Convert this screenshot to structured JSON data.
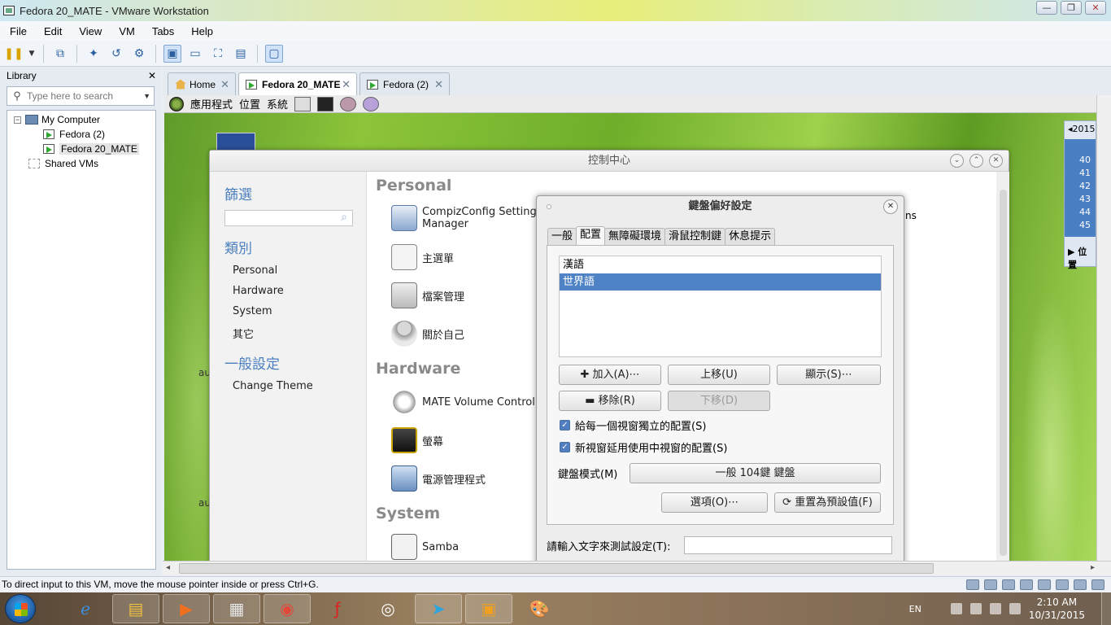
{
  "window": {
    "title": "Fedora 20_MATE - VMware Workstation",
    "controls": [
      "—",
      "❐",
      "✕"
    ]
  },
  "menu": [
    "File",
    "Edit",
    "View",
    "VM",
    "Tabs",
    "Help"
  ],
  "toolbar": {
    "icons": [
      "pause-icon",
      "dropdown-arrow-icon",
      "network-icon",
      "snapshot-icon",
      "revert-snapshot-icon",
      "snapshot-manager-icon",
      "normal-view-icon",
      "quick-switch-icon",
      "full-screen-icon",
      "unity-icon",
      "console-view-icon"
    ]
  },
  "library": {
    "title": "Library",
    "close": "✕",
    "search_placeholder": "Type here to search",
    "tree": [
      {
        "label": "My Computer",
        "level": 0,
        "expander": "−"
      },
      {
        "label": "Fedora (2)",
        "level": 1
      },
      {
        "label": "Fedora 20_MATE",
        "level": 1,
        "selected": true
      },
      {
        "label": "Shared VMs",
        "level": 0
      }
    ]
  },
  "tabs": [
    {
      "label": "Home",
      "close": "✕"
    },
    {
      "label": "Fedora 20_MATE",
      "close": "✕",
      "active": true
    },
    {
      "label": "Fedora (2)",
      "close": "✕"
    }
  ],
  "guest_panel": {
    "menus": [
      "應用程式",
      "位置",
      "系統"
    ]
  },
  "side_calendar": {
    "year": "◂2015",
    "weeks": [
      "40",
      "41",
      "42",
      "43",
      "44",
      "45"
    ],
    "position_label": "▶ 位置"
  },
  "control_center": {
    "title": "控制中心",
    "filter_heading": "篩選",
    "category_heading": "類別",
    "categories": [
      "Personal",
      "Hardware",
      "System",
      "其它"
    ],
    "general_heading": "一般設定",
    "change_theme": "Change Theme",
    "edge_text": "au",
    "sections": {
      "personal": "Personal",
      "hardware": "Hardware",
      "system": "System"
    },
    "items": {
      "compiz": "CompizConfig Setting Manager",
      "main_menu": "主選單",
      "file_mgmt": "檔案管理",
      "about_me": "關於自己",
      "volume": "MATE Volume Control",
      "monitor": "螢幕",
      "power": "電源管理程式",
      "samba": "Samba"
    },
    "overflow_text": "ns"
  },
  "keyboard_prefs": {
    "title": "鍵盤偏好設定",
    "close": "✕",
    "tabs": [
      "一般",
      "配置",
      "無障礙環境",
      "滑鼠控制鍵",
      "休息提示"
    ],
    "active_tab": "配置",
    "layouts": [
      "漢語",
      "世界語"
    ],
    "selected_layout": "世界語",
    "buttons": {
      "add": "✚ 加入(A)⋯",
      "up": "上移(U)",
      "show": "顯示(S)⋯",
      "remove": "▬ 移除(R)",
      "down": "下移(D)",
      "options": "選項(O)⋯",
      "reset": "⟳ 重置為預設值(F)"
    },
    "checkbox_separate": "給每一個視窗獨立的配置(S)",
    "checkbox_new_window": "新視窗延用使用中視窗的配置(S)",
    "model_label": "鍵盤模式(M)",
    "model_value": "一般 104鍵 鍵盤",
    "test_label": "請輸入文字來測試設定(T):"
  },
  "statusbar": {
    "text": "To direct input to this VM, move the mouse pointer inside or press Ctrl+G."
  },
  "taskbar": {
    "apps": [
      "ie-icon",
      "file-explorer-icon",
      "media-player-icon",
      "presentation-icon",
      "chrome-icon",
      "flash-icon",
      "sync-icon",
      "telegram-icon",
      "vmware-icon",
      "paint-icon"
    ],
    "lang": "EN",
    "time": "2:10 AM",
    "date": "10/31/2015"
  }
}
